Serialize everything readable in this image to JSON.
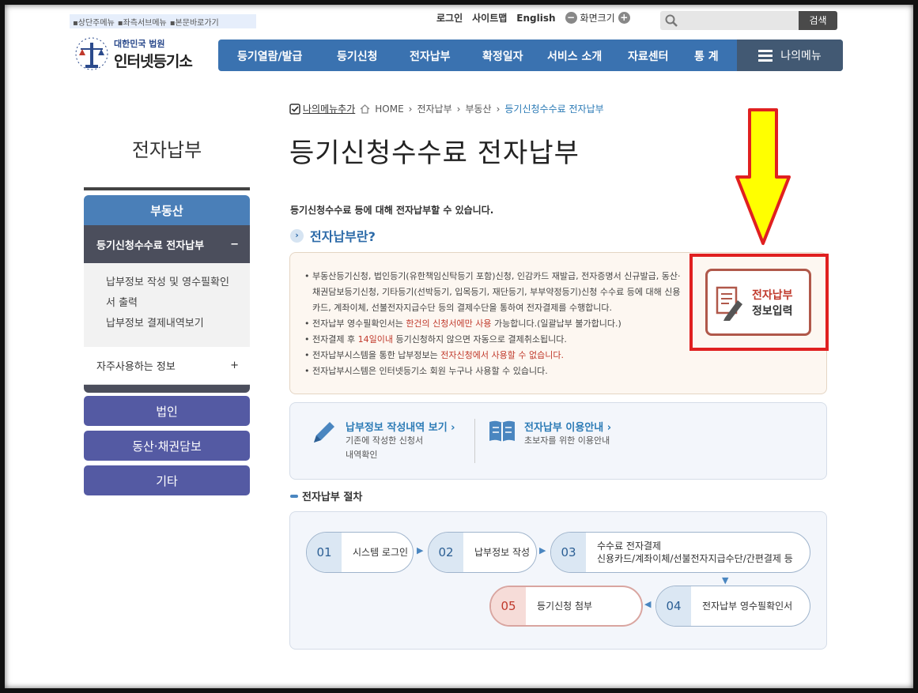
{
  "skip_links": [
    "▪상단주메뉴",
    "▪좌측서브메뉴",
    "▪본문바로가기"
  ],
  "util": {
    "login": "로그인",
    "sitemap": "사이트맵",
    "english": "English",
    "zoom_label": "화면크기",
    "zoom_out": "−",
    "zoom_in": "+",
    "search_button": "검색"
  },
  "logo": {
    "line1": "대한민국 법원",
    "line2": "인터넷등기소"
  },
  "gnb": {
    "items": [
      "등기열람/발급",
      "등기신청",
      "전자납부",
      "확정일자",
      "서비스 소개",
      "자료센터",
      "통 계"
    ],
    "my_menu": "나의메뉴"
  },
  "lnb": {
    "title": "전자납부",
    "category": "부동산",
    "selected": "등기신청수수료 전자납부",
    "selected_toggle": "−",
    "sub_items": [
      "납부정보 작성 및 영수필확인",
      "서 출력",
      "납부정보 결제내역보기"
    ],
    "frequent": "자주사용하는 정보",
    "frequent_toggle": "+",
    "buttons": [
      "법인",
      "동산·채권담보",
      "기타"
    ]
  },
  "breadcrumb": {
    "add_menu": "나의메뉴추가",
    "home": "HOME",
    "path": [
      "전자납부",
      "부동산"
    ],
    "current": "등기신청수수료 전자납부"
  },
  "page_title": "등기신청수수료 전자납부",
  "intro": "등기신청수수료 등에 대해 전자납부할 수 있습니다.",
  "subheading": "전자납부란?",
  "info": {
    "b1": "부동산등기신청, 법인등기(유한책임신탁등기 포함)신청, 인감카드 재발급, 전자증명서 신규발급, 동산·채권담보등기신청, 기타등기(선박등기, 입목등기, 재단등기, 부부약정등기)신청 수수료 등에 대해 신용카드, 계좌이체, 선불전자지급수단 등의 결제수단을 통하여 전자결제를 수행합니다.",
    "b2a": "전자납부 영수필확인서는 ",
    "b2b": "한건의 신청서에만 사용",
    "b2c": " 가능합니다.(일괄납부 불가합니다.)",
    "b3a": "전자결제 후 ",
    "b3b": "14일이내",
    "b3c": " 등기신청하지 않으면 자동으로 결제취소됩니다.",
    "b4a": "전자납부시스템을 통한 납부정보는 ",
    "b4b": "전자신청에서 사용할 수 없습니다.",
    "b5": "전자납부시스템은 인터넷등기소 회원 누구나 사용할 수 있습니다."
  },
  "pay_button": {
    "line1": "전자납부",
    "line2": "정보입력"
  },
  "links": [
    {
      "title": "납부정보 작성내역 보기 ›",
      "desc1": "기존에 작성한 신청서",
      "desc2": "내역확인"
    },
    {
      "title": "전자납부 이용안내 ›",
      "desc1": "초보자를 위한 이용안내"
    }
  ],
  "procedure_title": "전자납부 절차",
  "steps": [
    {
      "num": "01",
      "label": "시스템 로그인"
    },
    {
      "num": "02",
      "label": "납부정보 작성"
    },
    {
      "num": "03",
      "label": "수수료 전자결제",
      "label2": "신용카드/계좌이체/선불전자지급수단/간편결제 등"
    },
    {
      "num": "04",
      "label": "전자납부 영수필확인서"
    },
    {
      "num": "05",
      "label": "등기신청 첨부"
    }
  ],
  "colors": {
    "accent": "#3a72b0",
    "highlight_frame": "#e02020",
    "arrow": "#ffff00"
  }
}
